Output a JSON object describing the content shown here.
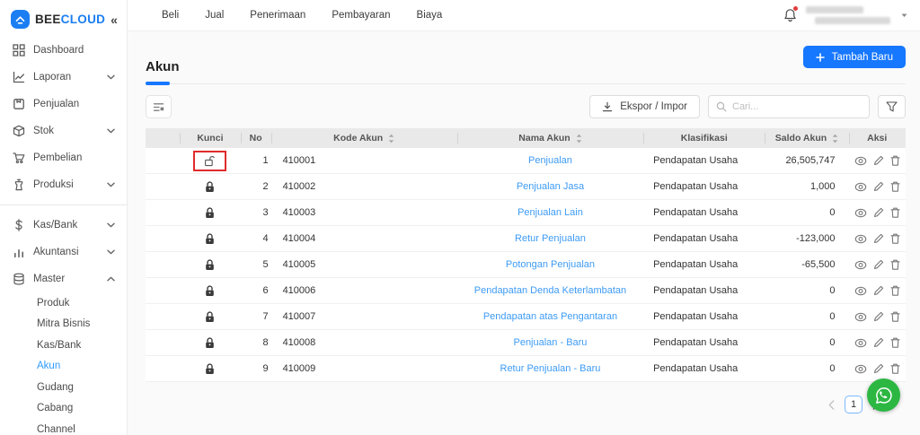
{
  "brand": {
    "name_bold": "BEE",
    "name_accent": "CLOUD",
    "collapse_glyph": "«"
  },
  "topnav": {
    "items": [
      "Beli",
      "Jual",
      "Penerimaan",
      "Pembayaran",
      "Biaya"
    ]
  },
  "sidebar": {
    "items": [
      {
        "label": "Dashboard",
        "icon": "dashboard-grid-icon",
        "chevron": "none",
        "group": 1
      },
      {
        "label": "Laporan",
        "icon": "report-chart-icon",
        "chevron": "down",
        "group": 1
      },
      {
        "label": "Penjualan",
        "icon": "sales-bag-icon",
        "chevron": "none",
        "group": 1
      },
      {
        "label": "Stok",
        "icon": "stock-box-icon",
        "chevron": "down",
        "group": 1
      },
      {
        "label": "Pembelian",
        "icon": "purchase-cart-icon",
        "chevron": "none",
        "group": 1
      },
      {
        "label": "Produksi",
        "icon": "production-icon",
        "chevron": "down",
        "group": 1
      },
      {
        "label": "Kas/Bank",
        "icon": "cash-dollar-icon",
        "chevron": "down",
        "group": 2
      },
      {
        "label": "Akuntansi",
        "icon": "accounting-bars-icon",
        "chevron": "down",
        "group": 2
      },
      {
        "label": "Master",
        "icon": "master-database-icon",
        "chevron": "up",
        "group": 2
      }
    ],
    "subitems": [
      {
        "label": "Produk",
        "active": false
      },
      {
        "label": "Mitra Bisnis",
        "active": false
      },
      {
        "label": "Kas/Bank",
        "active": false
      },
      {
        "label": "Akun",
        "active": true
      },
      {
        "label": "Gudang",
        "active": false
      },
      {
        "label": "Cabang",
        "active": false
      },
      {
        "label": "Channel",
        "active": false
      }
    ]
  },
  "page": {
    "title": "Akun",
    "add_button_label": "Tambah Baru",
    "export_button_label": "Ekspor / Impor",
    "search_placeholder": "Cari..."
  },
  "table": {
    "columns": {
      "kunci": "Kunci",
      "no": "No",
      "kode": "Kode Akun",
      "nama": "Nama Akun",
      "klasifikasi": "Klasifikasi",
      "saldo": "Saldo Akun",
      "aksi": "Aksi"
    },
    "rows": [
      {
        "no": "1",
        "kode": "410001",
        "nama": "Penjualan",
        "klasifikasi": "Pendapatan Usaha",
        "saldo": "26,505,747",
        "locked": false,
        "highlighted": true
      },
      {
        "no": "2",
        "kode": "410002",
        "nama": "Penjualan Jasa",
        "klasifikasi": "Pendapatan Usaha",
        "saldo": "1,000",
        "locked": true,
        "highlighted": false
      },
      {
        "no": "3",
        "kode": "410003",
        "nama": "Penjualan Lain",
        "klasifikasi": "Pendapatan Usaha",
        "saldo": "0",
        "locked": true,
        "highlighted": false
      },
      {
        "no": "4",
        "kode": "410004",
        "nama": "Retur Penjualan",
        "klasifikasi": "Pendapatan Usaha",
        "saldo": "-123,000",
        "locked": true,
        "highlighted": false
      },
      {
        "no": "5",
        "kode": "410005",
        "nama": "Potongan Penjualan",
        "klasifikasi": "Pendapatan Usaha",
        "saldo": "-65,500",
        "locked": true,
        "highlighted": false
      },
      {
        "no": "6",
        "kode": "410006",
        "nama": "Pendapatan Denda Keterlambatan",
        "klasifikasi": "Pendapatan Usaha",
        "saldo": "0",
        "locked": true,
        "highlighted": false
      },
      {
        "no": "7",
        "kode": "410007",
        "nama": "Pendapatan atas Pengantaran",
        "klasifikasi": "Pendapatan Usaha",
        "saldo": "0",
        "locked": true,
        "highlighted": false
      },
      {
        "no": "8",
        "kode": "410008",
        "nama": "Penjualan - Baru",
        "klasifikasi": "Pendapatan Usaha",
        "saldo": "0",
        "locked": true,
        "highlighted": false
      },
      {
        "no": "9",
        "kode": "410009",
        "nama": "Retur Penjualan - Baru",
        "klasifikasi": "Pendapatan Usaha",
        "saldo": "0",
        "locked": true,
        "highlighted": false
      }
    ]
  },
  "pagination": {
    "page": "1"
  },
  "colors": {
    "accent_blue": "#1677ff",
    "link_blue": "#3d9bf5",
    "annotation_red": "#e02b2b",
    "whatsapp_green": "#2cb742",
    "header_grey": "#e9e9e9"
  }
}
